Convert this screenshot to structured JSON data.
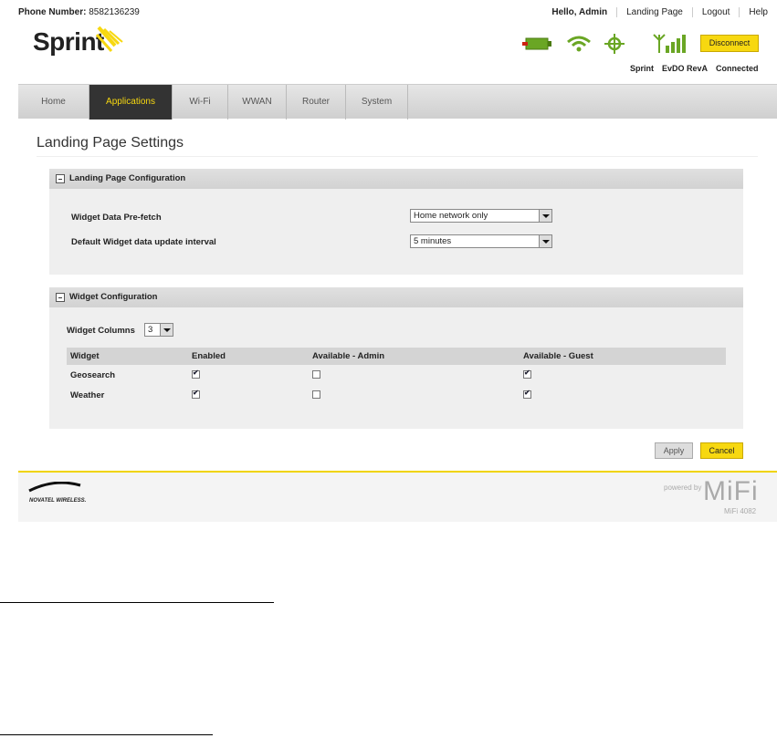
{
  "header": {
    "phone_label": "Phone Number:",
    "phone_value": "8582136239",
    "links": [
      "Hello, Admin",
      "Landing Page",
      "Logout",
      "Help"
    ],
    "logo": "Sprint",
    "disconnect_label": "Disconnect",
    "status": [
      "Sprint",
      "EvDO RevA",
      "Connected"
    ],
    "colors": {
      "accent": "#f7d810",
      "battery": "#6aa624",
      "nav_active": "#333333"
    },
    "icons": [
      "battery-icon",
      "wifi-icon",
      "gps-icon",
      "signal-icon"
    ]
  },
  "nav": {
    "tabs": [
      "Home",
      "Applications",
      "Wi-Fi",
      "WWAN",
      "Router",
      "System"
    ],
    "active": "Applications"
  },
  "page": {
    "title": "Landing Page Settings"
  },
  "landing_config": {
    "title": "Landing Page Configuration",
    "prefetch_label": "Widget Data Pre-fetch",
    "prefetch_value": "Home network only",
    "interval_label": "Default Widget data update interval",
    "interval_value": "5 minutes"
  },
  "widget_config": {
    "title": "Widget Configuration",
    "columns_label": "Widget Columns",
    "columns_value": "3",
    "headers": [
      "Widget",
      "Enabled",
      "Available - Admin",
      "Available - Guest"
    ],
    "rows": [
      {
        "name": "Geosearch",
        "enabled": true,
        "admin": false,
        "guest": true
      },
      {
        "name": "Weather",
        "enabled": true,
        "admin": false,
        "guest": true
      }
    ]
  },
  "actions": {
    "apply": "Apply",
    "cancel": "Cancel"
  },
  "footer": {
    "brand": "NOVATEL WIRELESS.",
    "powered": "powered by",
    "product": "MiFi",
    "model": "MiFi 4082"
  }
}
